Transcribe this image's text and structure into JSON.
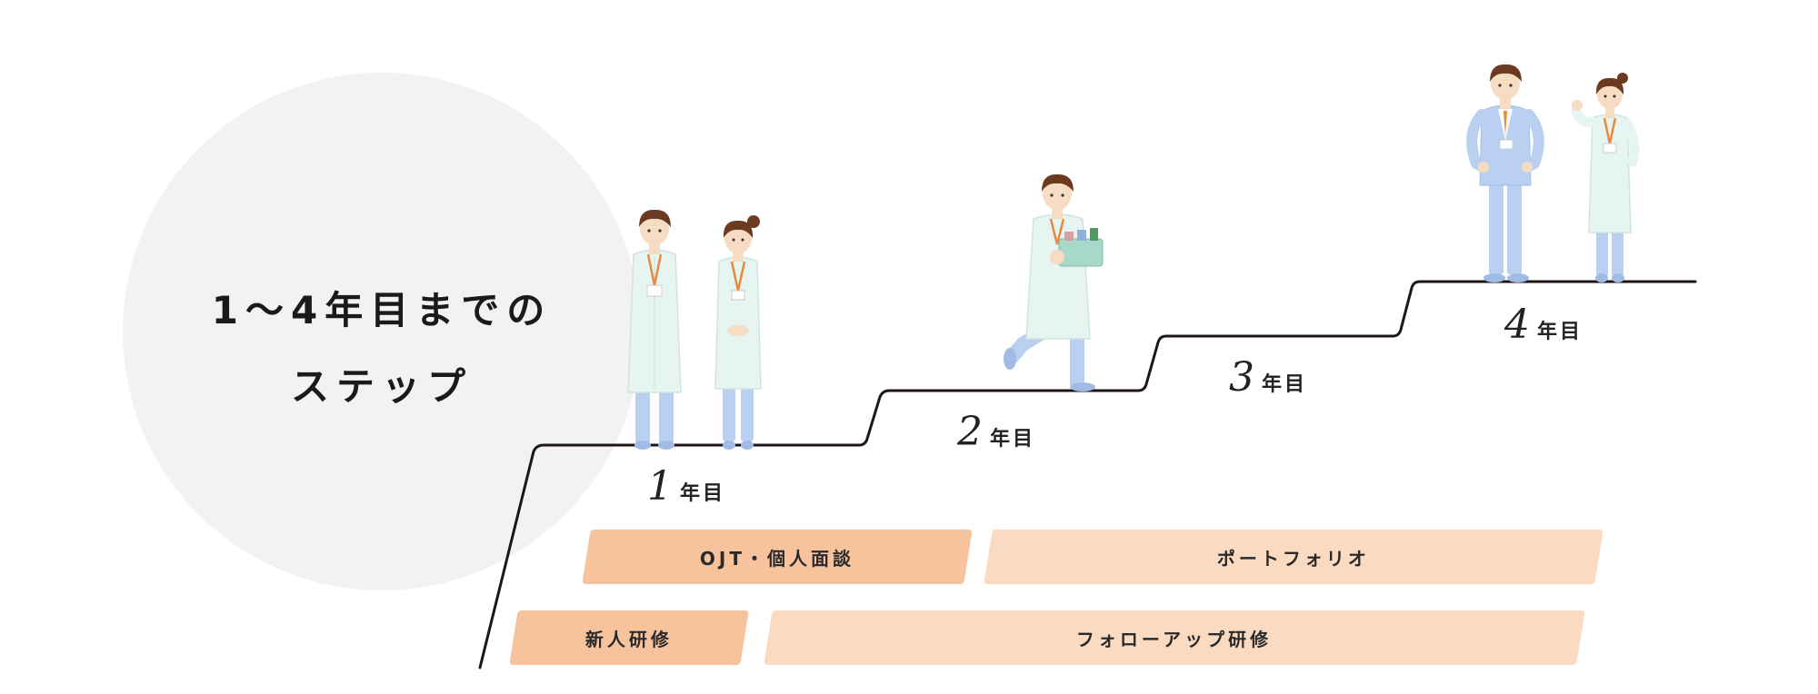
{
  "title": {
    "line1": "1〜4年目までの",
    "line2": "ステップ"
  },
  "years": [
    {
      "num": "1",
      "unit": "年目"
    },
    {
      "num": "2",
      "unit": "年目"
    },
    {
      "num": "3",
      "unit": "年目"
    },
    {
      "num": "4",
      "unit": "年目"
    }
  ],
  "programs": {
    "ojt": "OJT・個人面談",
    "portfolio": "ポートフォリオ",
    "new_training": "新人研修",
    "followup_training": "フォローアップ研修"
  },
  "colors": {
    "bar_dark": "#f7c39c",
    "bar_light": "#fbdac2",
    "circle": "#f2f2f2",
    "coat": "#e6f4f2",
    "pants": "#b9d0f0",
    "hair": "#6b3a1f",
    "lanyard": "#e88a3c"
  }
}
